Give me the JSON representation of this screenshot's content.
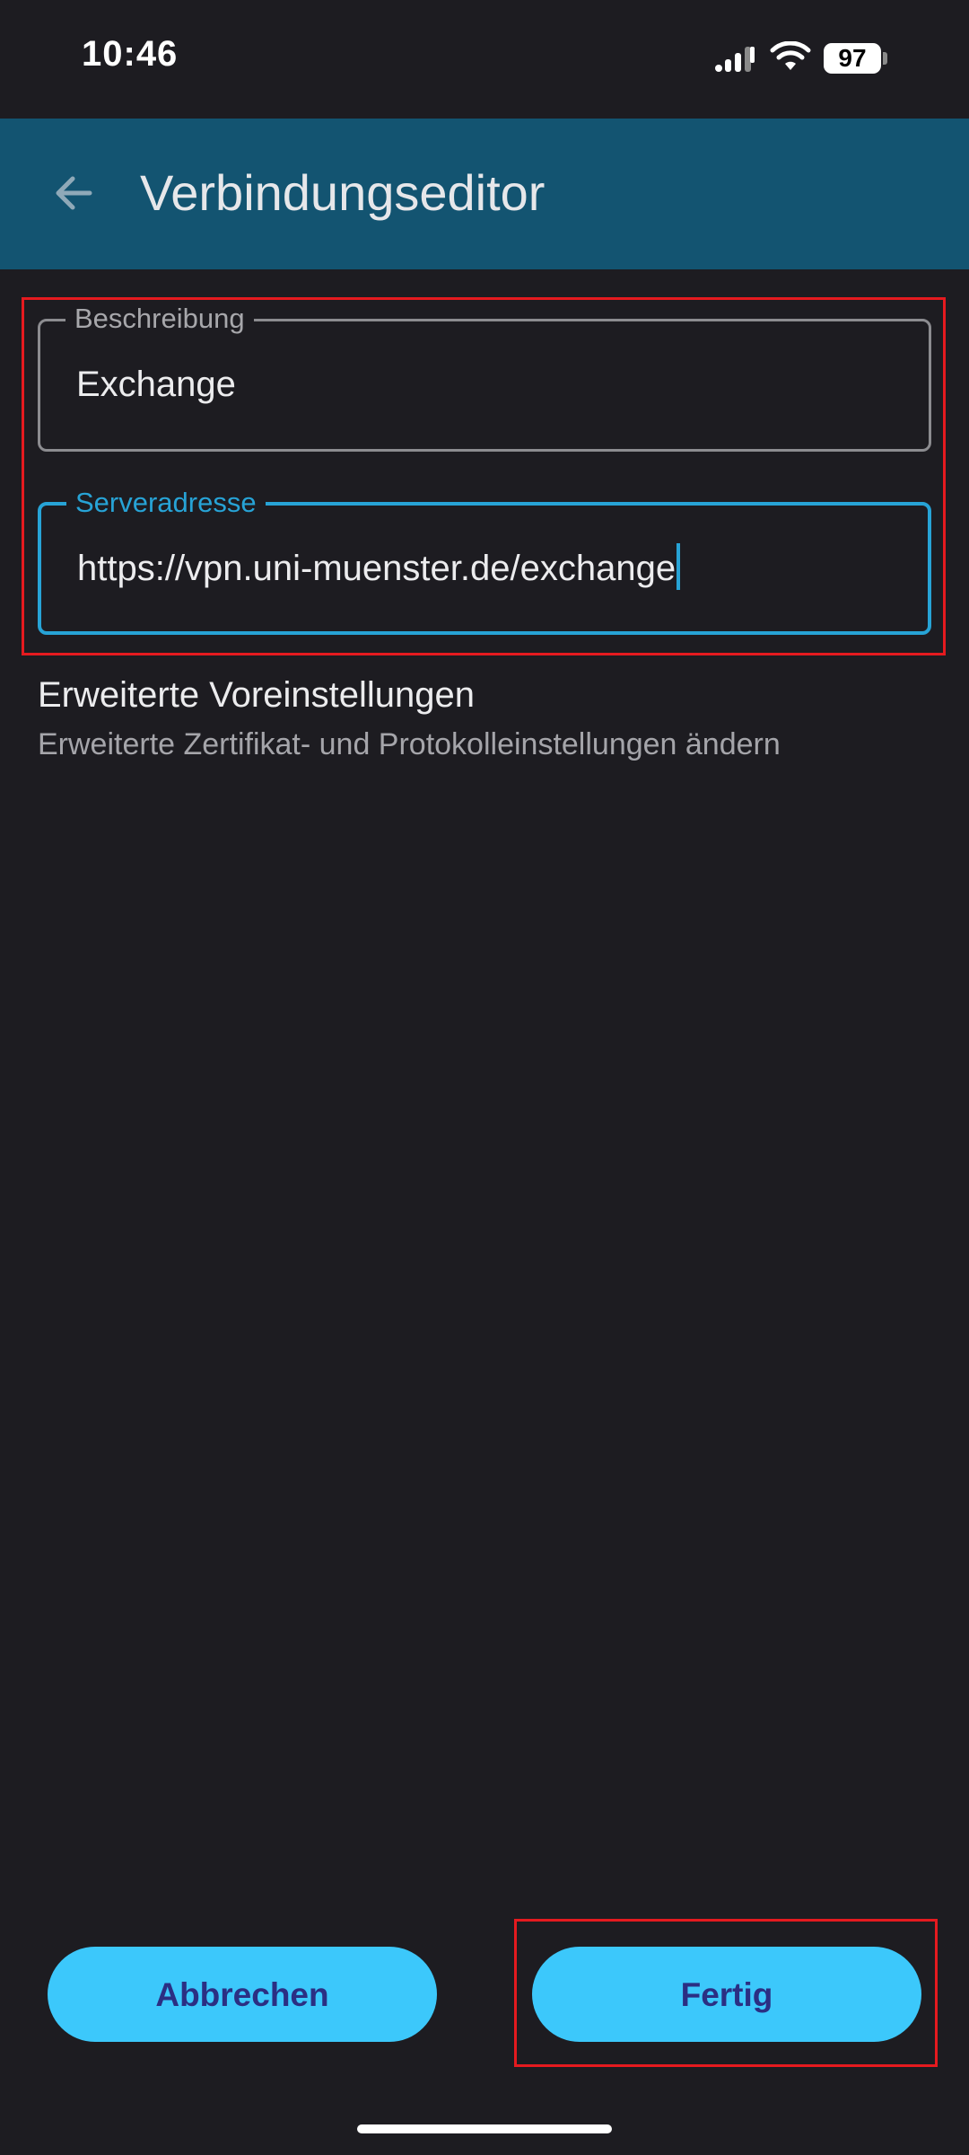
{
  "status_bar": {
    "time": "10:46",
    "battery": "97",
    "icons": [
      "signal-icon",
      "wifi-icon",
      "battery-icon"
    ]
  },
  "app_bar": {
    "title": "Verbindungseditor",
    "back_icon": "arrow-back-icon"
  },
  "form": {
    "description": {
      "label": "Beschreibung",
      "value": "Exchange"
    },
    "server": {
      "label": "Serveradresse",
      "value": "https://vpn.uni-muenster.de/exchange",
      "focused": true
    }
  },
  "advanced": {
    "title": "Erweiterte Voreinstellungen",
    "subtitle": "Erweiterte Zertifikat- und Protokolleinstellungen ändern"
  },
  "actions": {
    "cancel_label": "Abbrechen",
    "done_label": "Fertig"
  },
  "colors": {
    "background": "#1d1c21",
    "app_bar": "#135471",
    "accent": "#27a3d6",
    "button": "#3cc8fb",
    "button_text": "#2b2f83",
    "highlight": "#e51a1f"
  }
}
